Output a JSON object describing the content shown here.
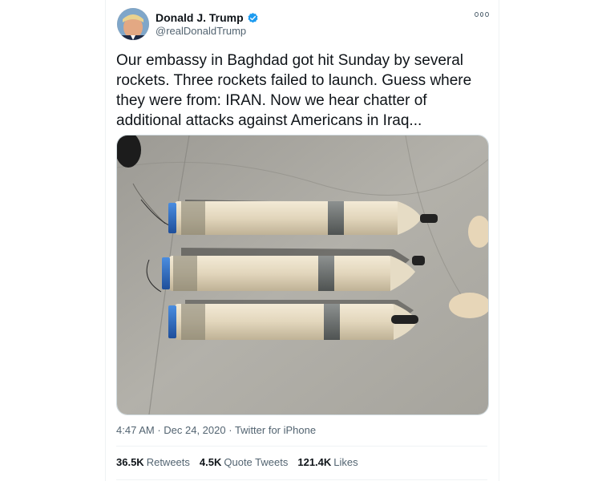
{
  "tweet": {
    "author_name": "Donald J. Trump",
    "handle": "@realDonaldTrump",
    "text": "Our embassy in Baghdad got hit Sunday by several rockets. Three rockets failed to launch. Guess where they were from: IRAN. Now we hear chatter of additional attacks against Americans in Iraq...",
    "time": "4:47 AM",
    "separator": " · ",
    "date": "Dec 24, 2020",
    "source": "Twitter for iPhone"
  },
  "stats": {
    "retweets_count": "36.5K",
    "retweets_label": "Retweets",
    "quotes_count": "4.5K",
    "quotes_label": "Quote Tweets",
    "likes_count": "121.4K",
    "likes_label": "Likes"
  },
  "icons": {
    "verified": "verified-badge-icon",
    "more": "more-options-icon"
  },
  "colors": {
    "verified_blue": "#1d9bf0",
    "text_primary": "#0f1419",
    "text_secondary": "#536471"
  }
}
